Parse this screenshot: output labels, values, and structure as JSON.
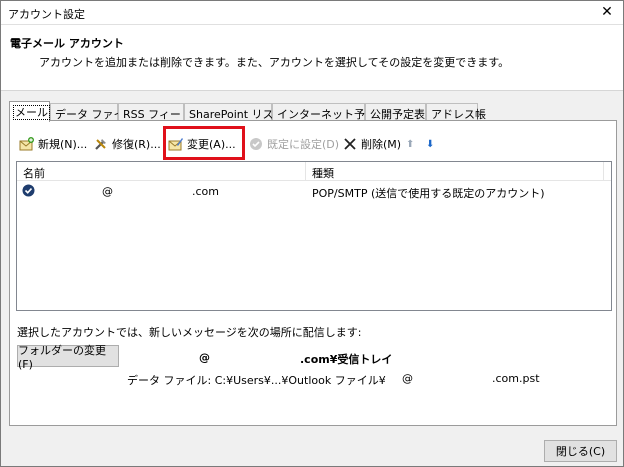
{
  "window": {
    "title": "アカウント設定",
    "close_glyph": "✕"
  },
  "header": {
    "title": "電子メール アカウント",
    "description": "アカウントを追加または削除できます。また、アカウントを選択してその設定を変更できます。"
  },
  "tabs": [
    {
      "label": "メール",
      "active": true
    },
    {
      "label": "データ ファイル"
    },
    {
      "label": "RSS フィード"
    },
    {
      "label": "SharePoint リスト"
    },
    {
      "label": "インターネット予定表"
    },
    {
      "label": "公開予定表"
    },
    {
      "label": "アドレス帳"
    }
  ],
  "toolbar": {
    "new_label": "新規(N)...",
    "repair_label": "修復(R)...",
    "change_label": "変更(A)...",
    "default_label": "既定に設定(D)",
    "delete_label": "削除(M)",
    "up_glyph": "⬆",
    "down_glyph": "⬇"
  },
  "list": {
    "columns": [
      "名前",
      "種類"
    ],
    "rows": [
      {
        "name_at": "@",
        "name_domain": ".com",
        "type": "POP/SMTP (送信で使用する既定のアカウント)"
      }
    ]
  },
  "delivery": {
    "text": "選択したアカウントでは、新しいメッセージを次の場所に配信します:",
    "folder_button": "フォルダーの変更(F)",
    "folder_at": "@",
    "folder_suffix": ".com¥受信トレイ",
    "datafile_prefix": "データ ファイル: C:¥Users¥...¥Outlook ファイル¥",
    "datafile_at": "@",
    "datafile_suffix": ".com.pst"
  },
  "footer": {
    "close_label": "閉じる(C)"
  },
  "colors": {
    "highlight": "#e0101a",
    "accent": "#1a66c8"
  }
}
